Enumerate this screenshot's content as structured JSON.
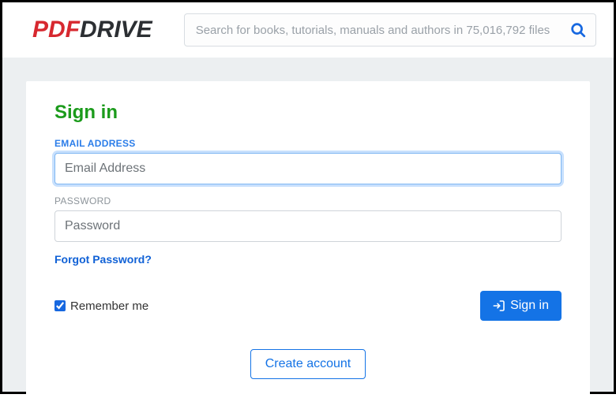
{
  "logo": {
    "part1": "PDF",
    "part2": "DRIVE"
  },
  "search": {
    "placeholder": "Search for books, tutorials, manuals and authors in 75,016,792 files"
  },
  "signin": {
    "title": "Sign in",
    "email_label": "EMAIL ADDRESS",
    "email_placeholder": "Email Address",
    "password_label": "PASSWORD",
    "password_placeholder": "Password",
    "forgot": "Forgot Password?",
    "remember": "Remember me",
    "remember_checked": true,
    "submit": "Sign in",
    "create": "Create account"
  }
}
